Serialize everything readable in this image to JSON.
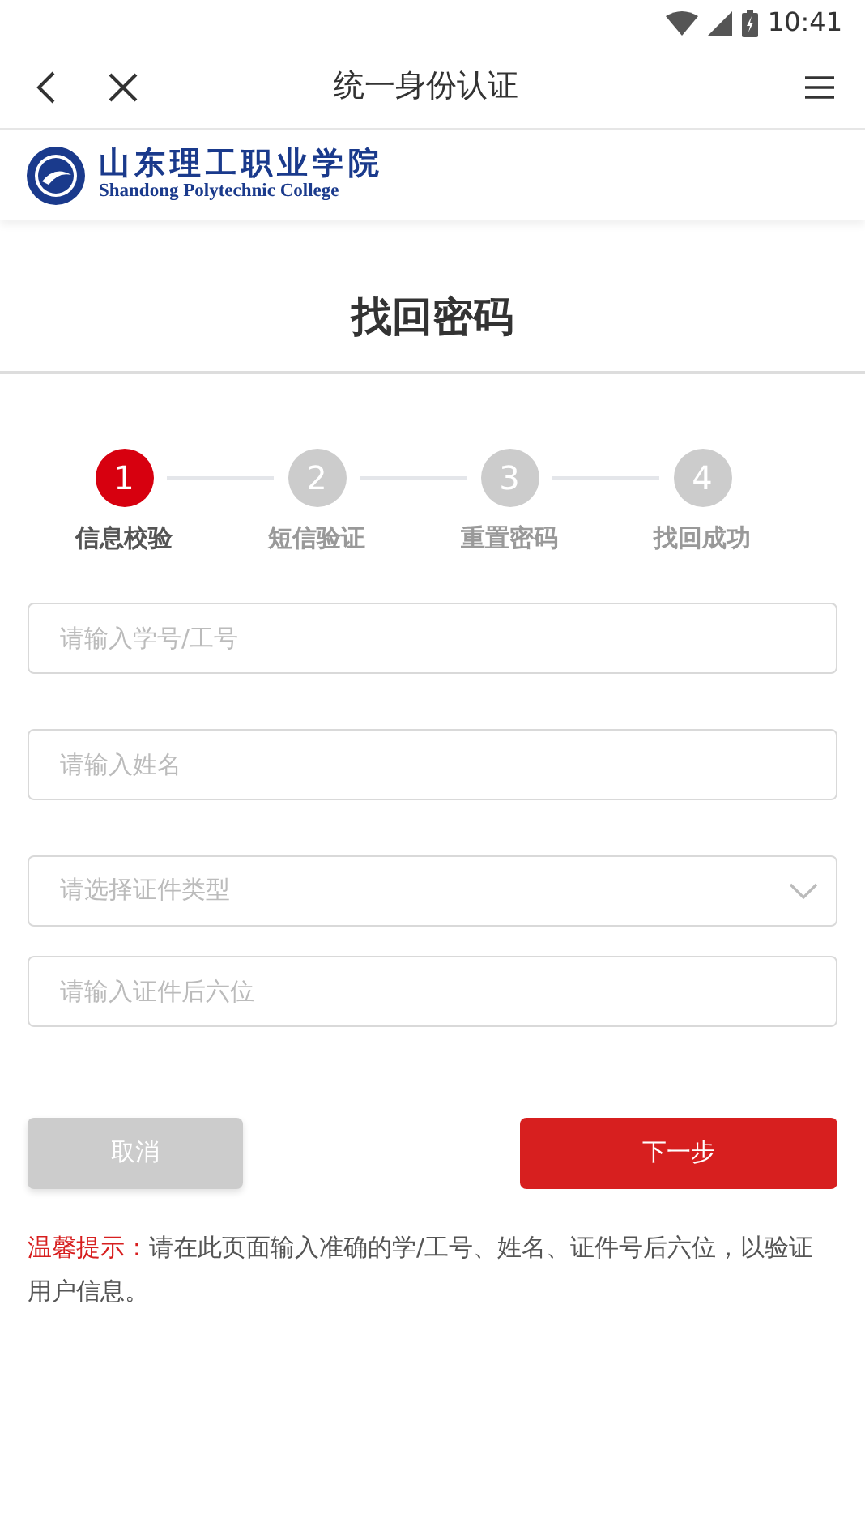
{
  "status_bar": {
    "time": "10:41"
  },
  "nav_bar": {
    "title": "统一身份认证"
  },
  "logo": {
    "name_cn": "山东理工职业学院",
    "name_en": "Shandong Polytechnic College"
  },
  "page_title": "找回密码",
  "steps": [
    {
      "number": "1",
      "label": "信息校验",
      "selected": true
    },
    {
      "number": "2",
      "label": "短信验证",
      "selected": false
    },
    {
      "number": "3",
      "label": "重置密码",
      "selected": false
    },
    {
      "number": "4",
      "label": "找回成功",
      "selected": false
    }
  ],
  "fields": [
    {
      "kind": "text",
      "placeholder": "请输入学号/工号"
    },
    {
      "kind": "text",
      "placeholder": "请输入姓名"
    },
    {
      "kind": "select",
      "placeholder": "请选择证件类型"
    },
    {
      "kind": "text",
      "placeholder": "请输入证件后六位"
    }
  ],
  "buttons": [
    {
      "kind": "secondary",
      "label": "取消"
    },
    {
      "kind": "primary",
      "label": "下一步"
    }
  ],
  "hint": {
    "label": "温馨提示：",
    "text": "请在此页面输入准确的学/工号、姓名、证件号后六位，以验证用户信息。"
  }
}
